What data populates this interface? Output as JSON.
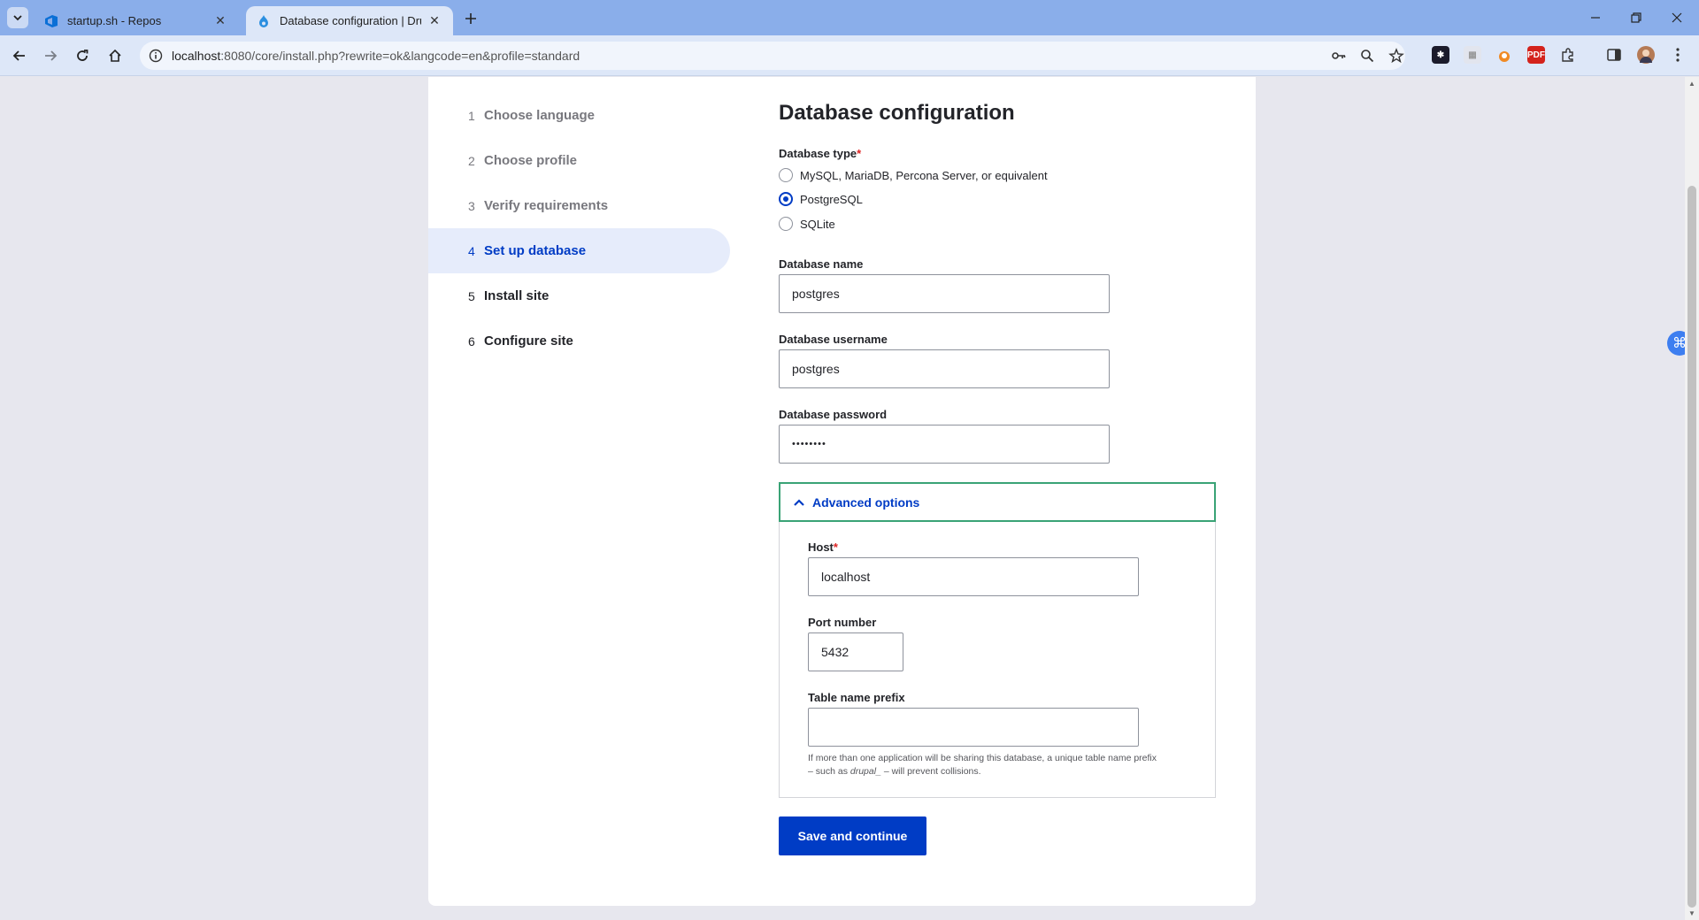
{
  "browser": {
    "tabs": [
      {
        "title": "startup.sh - Repos",
        "icon": "azure-devops-icon"
      },
      {
        "title": "Database configuration | Drupal",
        "icon": "drupal-icon"
      }
    ],
    "url_host": "localhost",
    "url_rest": ":8080/core/install.php?rewrite=ok&langcode=en&profile=standard"
  },
  "steps": [
    {
      "num": "1",
      "label": "Choose language"
    },
    {
      "num": "2",
      "label": "Choose profile"
    },
    {
      "num": "3",
      "label": "Verify requirements"
    },
    {
      "num": "4",
      "label": "Set up database"
    },
    {
      "num": "5",
      "label": "Install site"
    },
    {
      "num": "6",
      "label": "Configure site"
    }
  ],
  "page": {
    "title": "Database configuration",
    "db_type_label": "Database type",
    "required_mark": "*",
    "db_types": [
      {
        "label": "MySQL, MariaDB, Percona Server, or equivalent",
        "checked": false
      },
      {
        "label": "PostgreSQL",
        "checked": true
      },
      {
        "label": "SQLite",
        "checked": false
      }
    ],
    "db_name_label": "Database name",
    "db_name_value": "postgres",
    "db_user_label": "Database username",
    "db_user_value": "postgres",
    "db_pass_label": "Database password",
    "db_pass_value": "••••••••",
    "advanced_label": "Advanced options",
    "host_label": "Host",
    "host_value": "localhost",
    "port_label": "Port number",
    "port_value": "5432",
    "prefix_label": "Table name prefix",
    "prefix_value": "",
    "prefix_help_1": "If more than one application will be sharing this database, a unique table name prefix",
    "prefix_help_2": "– such as ",
    "prefix_help_em": "drupal_",
    "prefix_help_3": " – will prevent collisions.",
    "submit_label": "Save and continue"
  },
  "colors": {
    "accent": "#003cc5",
    "focus_border": "#3aa376",
    "required": "#dc2323"
  }
}
